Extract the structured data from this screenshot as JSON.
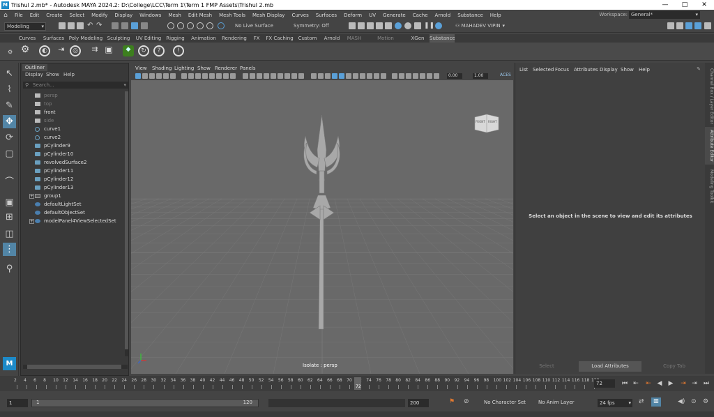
{
  "app": {
    "title": "Trishul 2.mb* - Autodesk MAYA 2024.2: D:\\College\\LCC\\Term 1\\Term 1 FMP Assets\\Trishul 2.mb",
    "icon_letter": "M",
    "window_controls": [
      "—",
      "□",
      "✕"
    ]
  },
  "menubar": {
    "items": [
      "File",
      "Edit",
      "Create",
      "Select",
      "Modify",
      "Display",
      "Windows",
      "Mesh",
      "Edit Mesh",
      "Mesh Tools",
      "Mesh Display",
      "Curves",
      "Surfaces",
      "Deform",
      "UV",
      "Generate",
      "Cache",
      "Arnold",
      "Substance",
      "Help"
    ],
    "workspace_label": "Workspace:",
    "workspace_value": "General*"
  },
  "statusline": {
    "mode": "Modeling",
    "live_surface": "No Live Surface",
    "symmetry": "Symmetry: Off",
    "user": "MAHADEV VIPIN"
  },
  "shelf": {
    "tabs": [
      "Curves",
      "Surfaces",
      "Poly Modeling",
      "Sculpting",
      "UV Editing",
      "Rigging",
      "Animation",
      "Rendering",
      "FX",
      "FX Caching",
      "Custom",
      "Arnold",
      "MASH",
      "Motion Graphics",
      "XGen",
      "Substance"
    ],
    "active_tab": "Substance"
  },
  "outliner": {
    "title": "Outliner",
    "menus": [
      "Display",
      "Show",
      "Help"
    ],
    "search_placeholder": "Search...",
    "items": [
      {
        "label": "persp",
        "icon": "camera-icon",
        "hidden": true
      },
      {
        "label": "top",
        "icon": "camera-icon",
        "hidden": true
      },
      {
        "label": "front",
        "icon": "camera-icon",
        "hidden": false
      },
      {
        "label": "side",
        "icon": "camera-icon",
        "hidden": true
      },
      {
        "label": "curve1",
        "icon": "curve-icon",
        "hidden": false
      },
      {
        "label": "curve2",
        "icon": "curve-icon",
        "hidden": false
      },
      {
        "label": "pCylinder9",
        "icon": "mesh-icon",
        "hidden": false
      },
      {
        "label": "pCylinder10",
        "icon": "mesh-icon",
        "hidden": false
      },
      {
        "label": "revolvedSurface2",
        "icon": "mesh-icon",
        "hidden": false
      },
      {
        "label": "pCylinder11",
        "icon": "mesh-icon",
        "hidden": false
      },
      {
        "label": "pCylinder12",
        "icon": "mesh-icon",
        "hidden": false
      },
      {
        "label": "pCylinder13",
        "icon": "mesh-icon",
        "hidden": false
      },
      {
        "label": "group1",
        "icon": "group-icon",
        "hidden": false,
        "expandable": true
      },
      {
        "label": "defaultLightSet",
        "icon": "set-icon",
        "hidden": false
      },
      {
        "label": "defaultObjectSet",
        "icon": "set-icon",
        "hidden": false
      },
      {
        "label": "modelPanel4ViewSelectedSet",
        "icon": "set-icon",
        "hidden": false,
        "expandable": true
      }
    ]
  },
  "viewport": {
    "menus": [
      "View",
      "Shading",
      "Lighting",
      "Show",
      "Renderer",
      "Panels"
    ],
    "field_a": "0.00",
    "field_b": "1.00",
    "color_mgmt": "ACES",
    "status": "Isolate : persp",
    "viewcube_front": "FRONT",
    "viewcube_right": "RIGHT"
  },
  "attribute_editor": {
    "menus": [
      "List",
      "Selected",
      "Focus",
      "Attributes",
      "Display",
      "Show",
      "Help"
    ],
    "message": "Select an object in the scene to view and edit its attributes",
    "buttons": [
      "Select",
      "Load Attributes",
      "Copy Tab"
    ],
    "side_tabs": [
      "Channel Box / Layer Editor",
      "Attribute Editor",
      "Modeling Toolkit"
    ],
    "active_side_tab": "Attribute Editor"
  },
  "timeline": {
    "ticks": [
      2,
      4,
      6,
      8,
      10,
      12,
      14,
      16,
      18,
      20,
      22,
      24,
      26,
      28,
      30,
      32,
      34,
      36,
      38,
      40,
      42,
      44,
      46,
      48,
      50,
      52,
      54,
      56,
      58,
      60,
      62,
      64,
      66,
      68,
      70,
      72,
      74,
      76,
      78,
      80,
      82,
      84,
      86,
      88,
      90,
      92,
      94,
      96,
      98,
      100,
      102,
      104,
      106,
      108,
      110,
      112,
      114,
      116,
      118,
      120
    ],
    "playhead_label": "72",
    "current_frame": "72"
  },
  "range": {
    "start": "1",
    "range_start": "1",
    "range_end": "120",
    "end": "200",
    "character_set": "No Character Set",
    "anim_layer": "No Anim Layer",
    "fps": "24 fps"
  }
}
